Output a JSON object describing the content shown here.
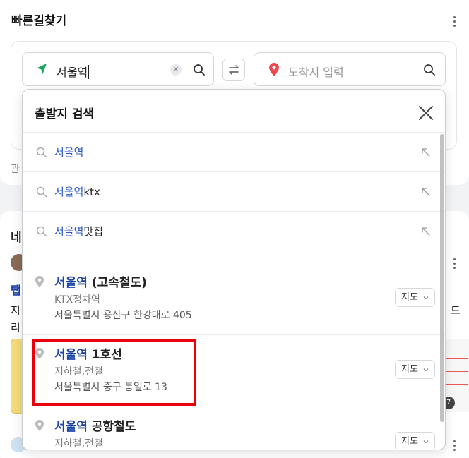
{
  "panel": {
    "title": "빠른길찾기"
  },
  "start_input": {
    "value": "서울역"
  },
  "end_input": {
    "placeholder": "도착지 입력"
  },
  "behind": {
    "related_label": "관",
    "section_title_partial": "네",
    "item_title_partial": "탭",
    "text_line1_partial": "지",
    "text_line2_partial": "리",
    "right_char": "드",
    "badge_count": "7"
  },
  "dropdown": {
    "title": "출발지 검색",
    "suggestions": [
      {
        "highlight": "서울역",
        "rest": ""
      },
      {
        "highlight": "서울역",
        "rest": "ktx"
      },
      {
        "highlight": "서울역",
        "rest": "맛집"
      }
    ],
    "places": [
      {
        "highlight": "서울역",
        "rest": " (고속철도)",
        "category": "KTX정차역",
        "address": "서울특별시 용산구 한강대로 405",
        "map_label": "지도"
      },
      {
        "highlight": "서울역",
        "rest": " 1호선",
        "category": "지하철,전철",
        "address": "서울특별시 중구 통일로 13",
        "map_label": "지도"
      },
      {
        "highlight": "서울역",
        "rest": " 공항철도",
        "category": "지하철,전철",
        "address": "",
        "map_label": "지도"
      }
    ]
  },
  "colors": {
    "accent": "#2a56c6",
    "start_pin": "#1ea362",
    "end_pin": "#f0464d",
    "highlight_border": "#e8000b"
  },
  "icons": [
    "direction-arrow-icon",
    "clear-icon",
    "search-icon",
    "swap-icon",
    "location-pin-icon",
    "close-icon",
    "fill-arrow-icon",
    "place-pin-icon",
    "chevron-down-icon",
    "more-icon"
  ]
}
